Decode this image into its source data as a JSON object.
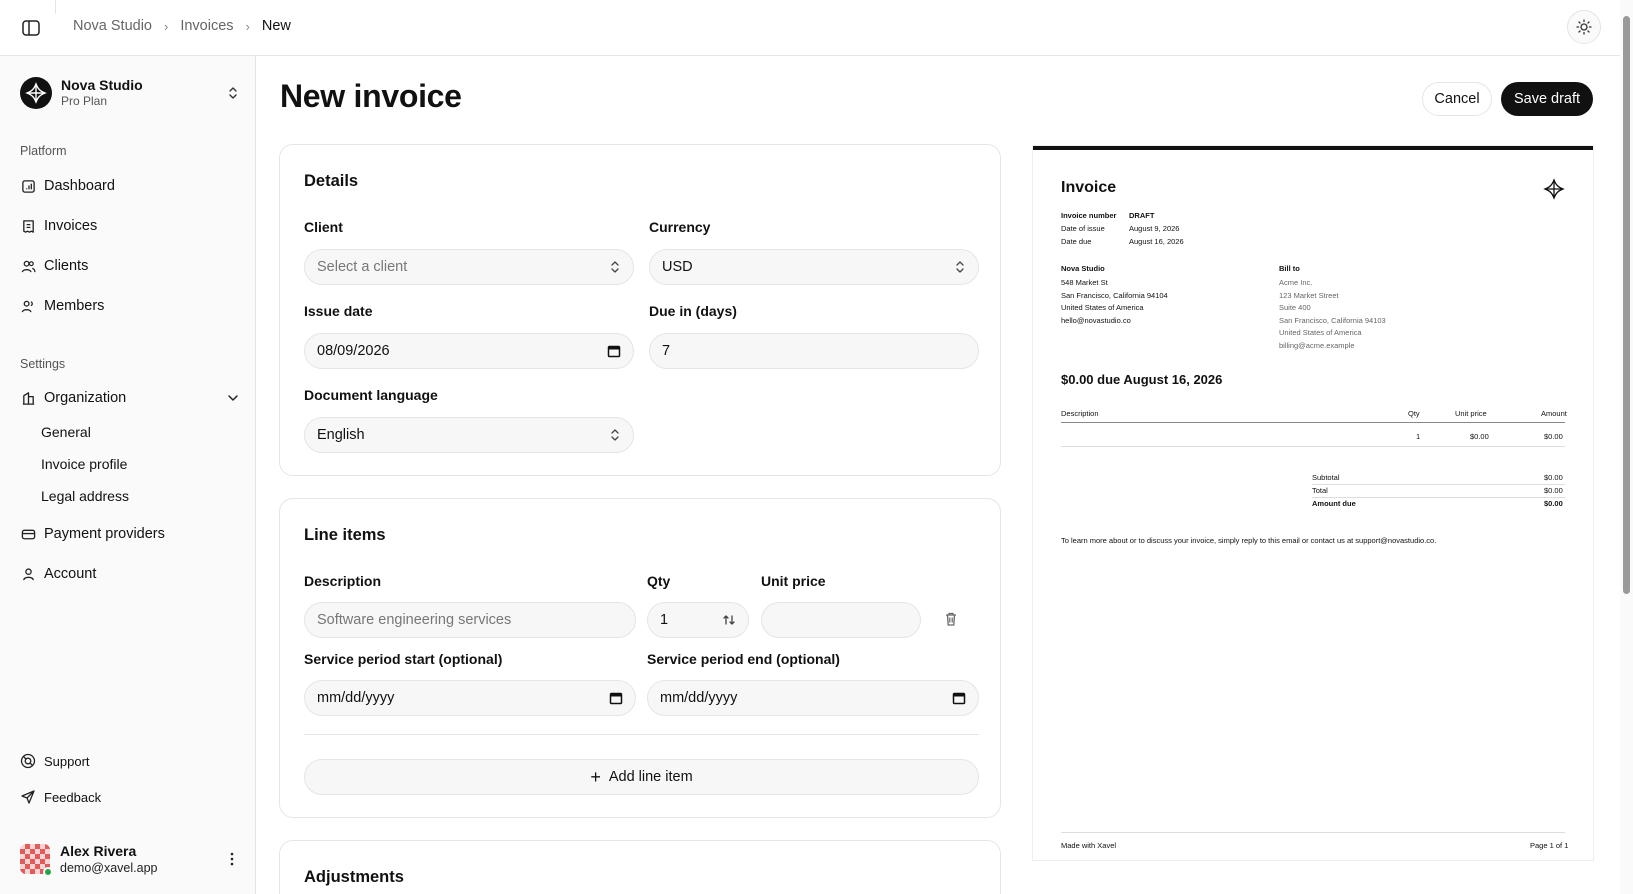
{
  "breadcrumb": [
    "Nova Studio",
    "Invoices",
    "New"
  ],
  "org": {
    "name": "Nova Studio",
    "plan": "Pro Plan"
  },
  "sidebar": {
    "platform_label": "Platform",
    "platform_items": [
      {
        "label": "Dashboard",
        "icon": "dashboard-icon"
      },
      {
        "label": "Invoices",
        "icon": "receipt-icon"
      },
      {
        "label": "Clients",
        "icon": "users-icon"
      },
      {
        "label": "Members",
        "icon": "members-icon"
      }
    ],
    "settings_label": "Settings",
    "organization_label": "Organization",
    "org_subitems": [
      "General",
      "Invoice profile",
      "Legal address"
    ],
    "payment_label": "Payment providers",
    "account_label": "Account",
    "support_label": "Support",
    "feedback_label": "Feedback"
  },
  "user": {
    "name": "Alex Rivera",
    "email": "demo@xavel.app"
  },
  "page": {
    "title": "New invoice",
    "cancel": "Cancel",
    "save": "Save draft"
  },
  "details": {
    "title": "Details",
    "client_label": "Client",
    "client_placeholder": "Select a client",
    "currency_label": "Currency",
    "currency_value": "USD",
    "issue_label": "Issue date",
    "issue_value": "08/09/2026",
    "due_label": "Due in (days)",
    "due_value": "7",
    "language_label": "Document language",
    "language_value": "English"
  },
  "line_items": {
    "title": "Line items",
    "desc_label": "Description",
    "desc_placeholder": "Software engineering services",
    "qty_label": "Qty",
    "qty_value": "1",
    "price_label": "Unit price",
    "price_value": "",
    "start_label": "Service period start (optional)",
    "end_label": "Service period end (optional)",
    "date_placeholder": "mm/dd/yyyy",
    "add_label": "Add line item"
  },
  "adjustments": {
    "title": "Adjustments"
  },
  "preview": {
    "title": "Invoice",
    "meta": [
      {
        "k": "Invoice number",
        "v": "DRAFT"
      },
      {
        "k": "Date of issue",
        "v": "August 9, 2026"
      },
      {
        "k": "Date due",
        "v": "August 16, 2026"
      }
    ],
    "from_name": "Nova Studio",
    "from_lines": [
      "548 Market St",
      "San Francisco, California 94104",
      "United States of America",
      "hello@novastudio.co"
    ],
    "bill_to_label": "Bill to",
    "bill_lines": [
      "Acme Inc.",
      "123 Market Street",
      "Suite 400",
      "San Francisco, California 94103",
      "United States of America",
      "billing@acme.example"
    ],
    "due_headline": "$0.00 due August 16, 2026",
    "table_headers": {
      "desc": "Description",
      "qty": "Qty",
      "unit": "Unit price",
      "amount": "Amount"
    },
    "row": {
      "qty": "1",
      "unit": "$0.00",
      "amount": "$0.00"
    },
    "subtotal_label": "Subtotal",
    "subtotal": "$0.00",
    "total_label": "Total",
    "total": "$0.00",
    "amount_due_label": "Amount due",
    "amount_due": "$0.00",
    "note": "To learn more about or to discuss your invoice, simply reply to this email or contact us at support@novastudio.co.",
    "footer_left": "Made with Xavel",
    "footer_right": "Page 1 of 1"
  }
}
